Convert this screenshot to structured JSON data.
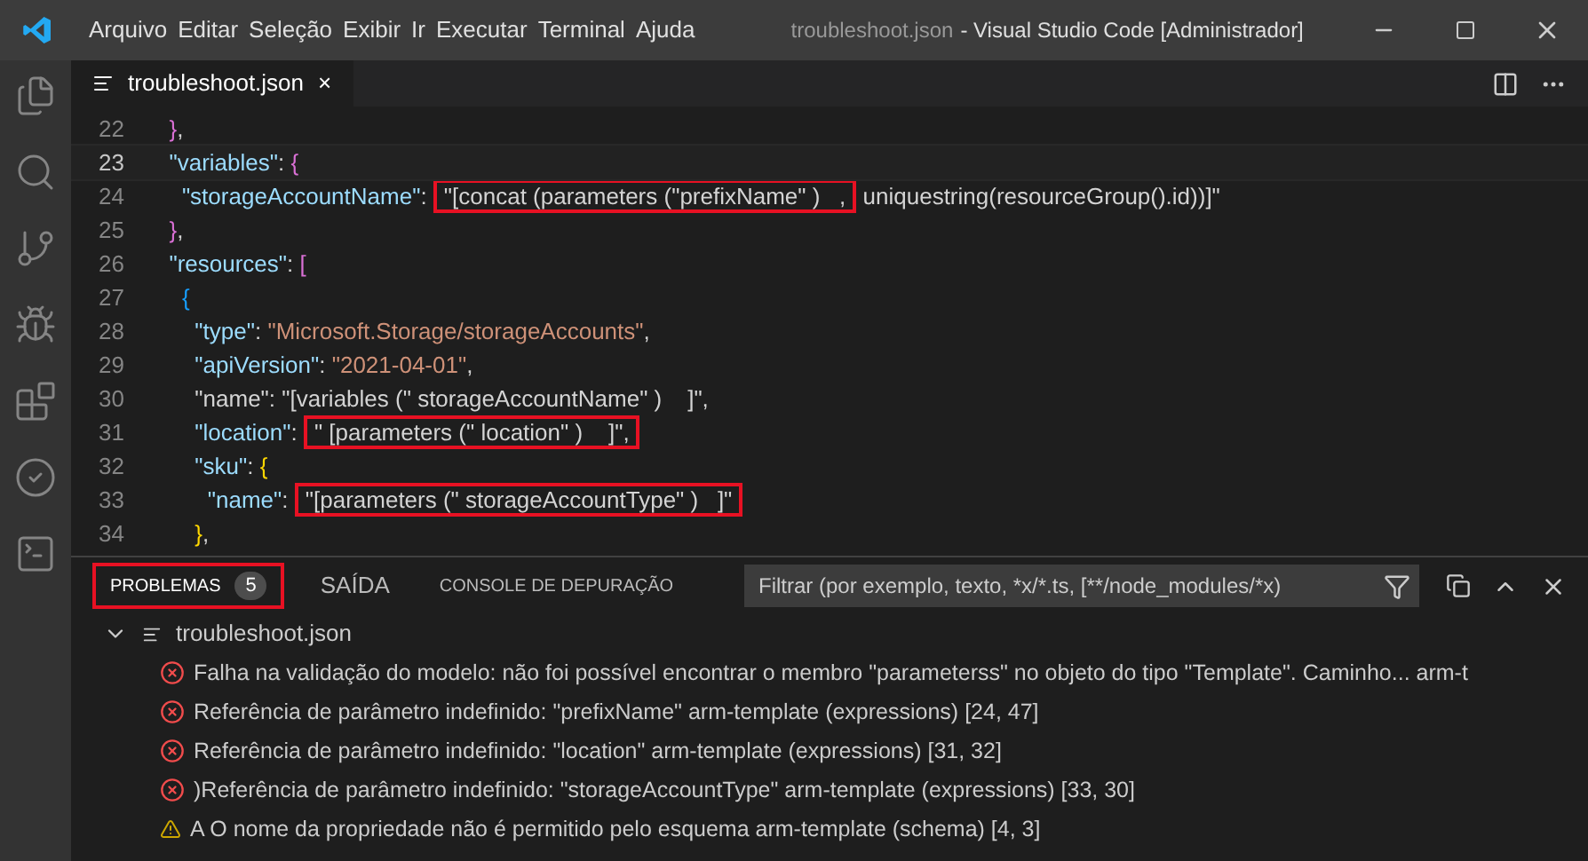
{
  "window": {
    "menu": [
      "Arquivo",
      "Editar",
      "Seleção",
      "Exibir",
      "Ir",
      "Executar",
      "Terminal",
      "Ajuda"
    ],
    "file_title": "troubleshoot.json",
    "app_title": "- Visual Studio Code [Administrador]"
  },
  "editor_tab": {
    "label": "troubleshoot.json",
    "close": "×"
  },
  "code": [
    {
      "number": "22",
      "current": false,
      "tokens": [
        {
          "kind": "bracket2",
          "text": "  }"
        },
        {
          "kind": "text",
          "text": ","
        }
      ]
    },
    {
      "number": "23",
      "current": true,
      "tokens": [
        {
          "kind": "key",
          "text": "  \"variables\""
        },
        {
          "kind": "text",
          "text": ": "
        },
        {
          "kind": "bracket2",
          "text": "{"
        }
      ]
    },
    {
      "number": "24",
      "current": false,
      "tokens": [
        {
          "kind": "key",
          "text": "    \"storageAccountName\""
        },
        {
          "kind": "text",
          "text": ": "
        },
        {
          "kind": "boxed",
          "text": "\"[concat (parameters (\"prefixName\" )   ,"
        },
        {
          "kind": "text",
          "text": " uniquestring(resourceGroup().id))]\""
        }
      ]
    },
    {
      "number": "25",
      "current": false,
      "tokens": [
        {
          "kind": "bracket2",
          "text": "  }"
        },
        {
          "kind": "text",
          "text": ","
        }
      ]
    },
    {
      "number": "26",
      "current": false,
      "tokens": [
        {
          "kind": "key",
          "text": "  \"resources\""
        },
        {
          "kind": "text",
          "text": ": "
        },
        {
          "kind": "bracket2",
          "text": "["
        }
      ]
    },
    {
      "number": "27",
      "current": false,
      "tokens": [
        {
          "kind": "bracket3",
          "text": "    {"
        }
      ]
    },
    {
      "number": "28",
      "current": false,
      "tokens": [
        {
          "kind": "key",
          "text": "      \"type\""
        },
        {
          "kind": "text",
          "text": ": "
        },
        {
          "kind": "string",
          "text": "\"Microsoft.Storage/storageAccounts\""
        },
        {
          "kind": "text",
          "text": ","
        }
      ]
    },
    {
      "number": "29",
      "current": false,
      "tokens": [
        {
          "kind": "key",
          "text": "      \"apiVersion\""
        },
        {
          "kind": "text",
          "text": ": "
        },
        {
          "kind": "string",
          "text": "\"2021-04-01\""
        },
        {
          "kind": "text",
          "text": ","
        }
      ]
    },
    {
      "number": "30",
      "current": false,
      "tokens": [
        {
          "kind": "text",
          "text": "      \"name\": \"[variables (\" storageAccountName\" )    ]\","
        }
      ]
    },
    {
      "number": "31",
      "current": false,
      "tokens": [
        {
          "kind": "key",
          "text": "      \"location\""
        },
        {
          "kind": "text",
          "text": ": "
        },
        {
          "kind": "boxed",
          "text": "\" [parameters (\" location\" )    ]\","
        }
      ]
    },
    {
      "number": "32",
      "current": false,
      "tokens": [
        {
          "kind": "key",
          "text": "      \"sku\""
        },
        {
          "kind": "text",
          "text": ": "
        },
        {
          "kind": "bracket1",
          "text": "{"
        }
      ]
    },
    {
      "number": "33",
      "current": false,
      "tokens": [
        {
          "kind": "key",
          "text": "        \"name\""
        },
        {
          "kind": "text",
          "text": ": "
        },
        {
          "kind": "boxed",
          "text": "\"[parameters (\" storageAccountType\" )   ]\""
        }
      ]
    },
    {
      "number": "34",
      "current": false,
      "tokens": [
        {
          "kind": "bracket1",
          "text": "      }"
        },
        {
          "kind": "text",
          "text": ","
        }
      ]
    }
  ],
  "panel": {
    "tabs": [
      {
        "label": "PROBLEMAS",
        "badge": "5",
        "selected": true,
        "boxed": true
      },
      {
        "label": "SAÍDA",
        "selected": false,
        "boxed": false
      },
      {
        "label": "CONSOLE DE DEPURAÇÃO",
        "selected": false,
        "boxed": false
      }
    ],
    "filter": {
      "placeholder": "Filtrar (por exemplo, texto, *x/*.ts, [**/node_modules/*x)"
    },
    "file": {
      "label": "troubleshoot.json",
      "expanded": true
    },
    "problems": [
      {
        "kind": "error",
        "text": "Falha na validação do modelo: não foi possível encontrar o membro \"parameterss\" no objeto do tipo \"Template\". Caminho...  arm-t"
      },
      {
        "kind": "error",
        "text": "Referência de parâmetro indefinido: \"prefixName\" arm-template (expressions) [24, 47]"
      },
      {
        "kind": "error",
        "text": "Referência de parâmetro indefinido: \"location\" arm-template (expressions) [31, 32]"
      },
      {
        "kind": "error",
        "text": ")Referência de parâmetro indefinido: \"storageAccountType\" arm-template (expressions) [33, 30]"
      },
      {
        "kind": "warning",
        "text": "A O nome da propriedade não é permitido pelo esquema arm-template (schema) [4, 3]"
      }
    ]
  }
}
